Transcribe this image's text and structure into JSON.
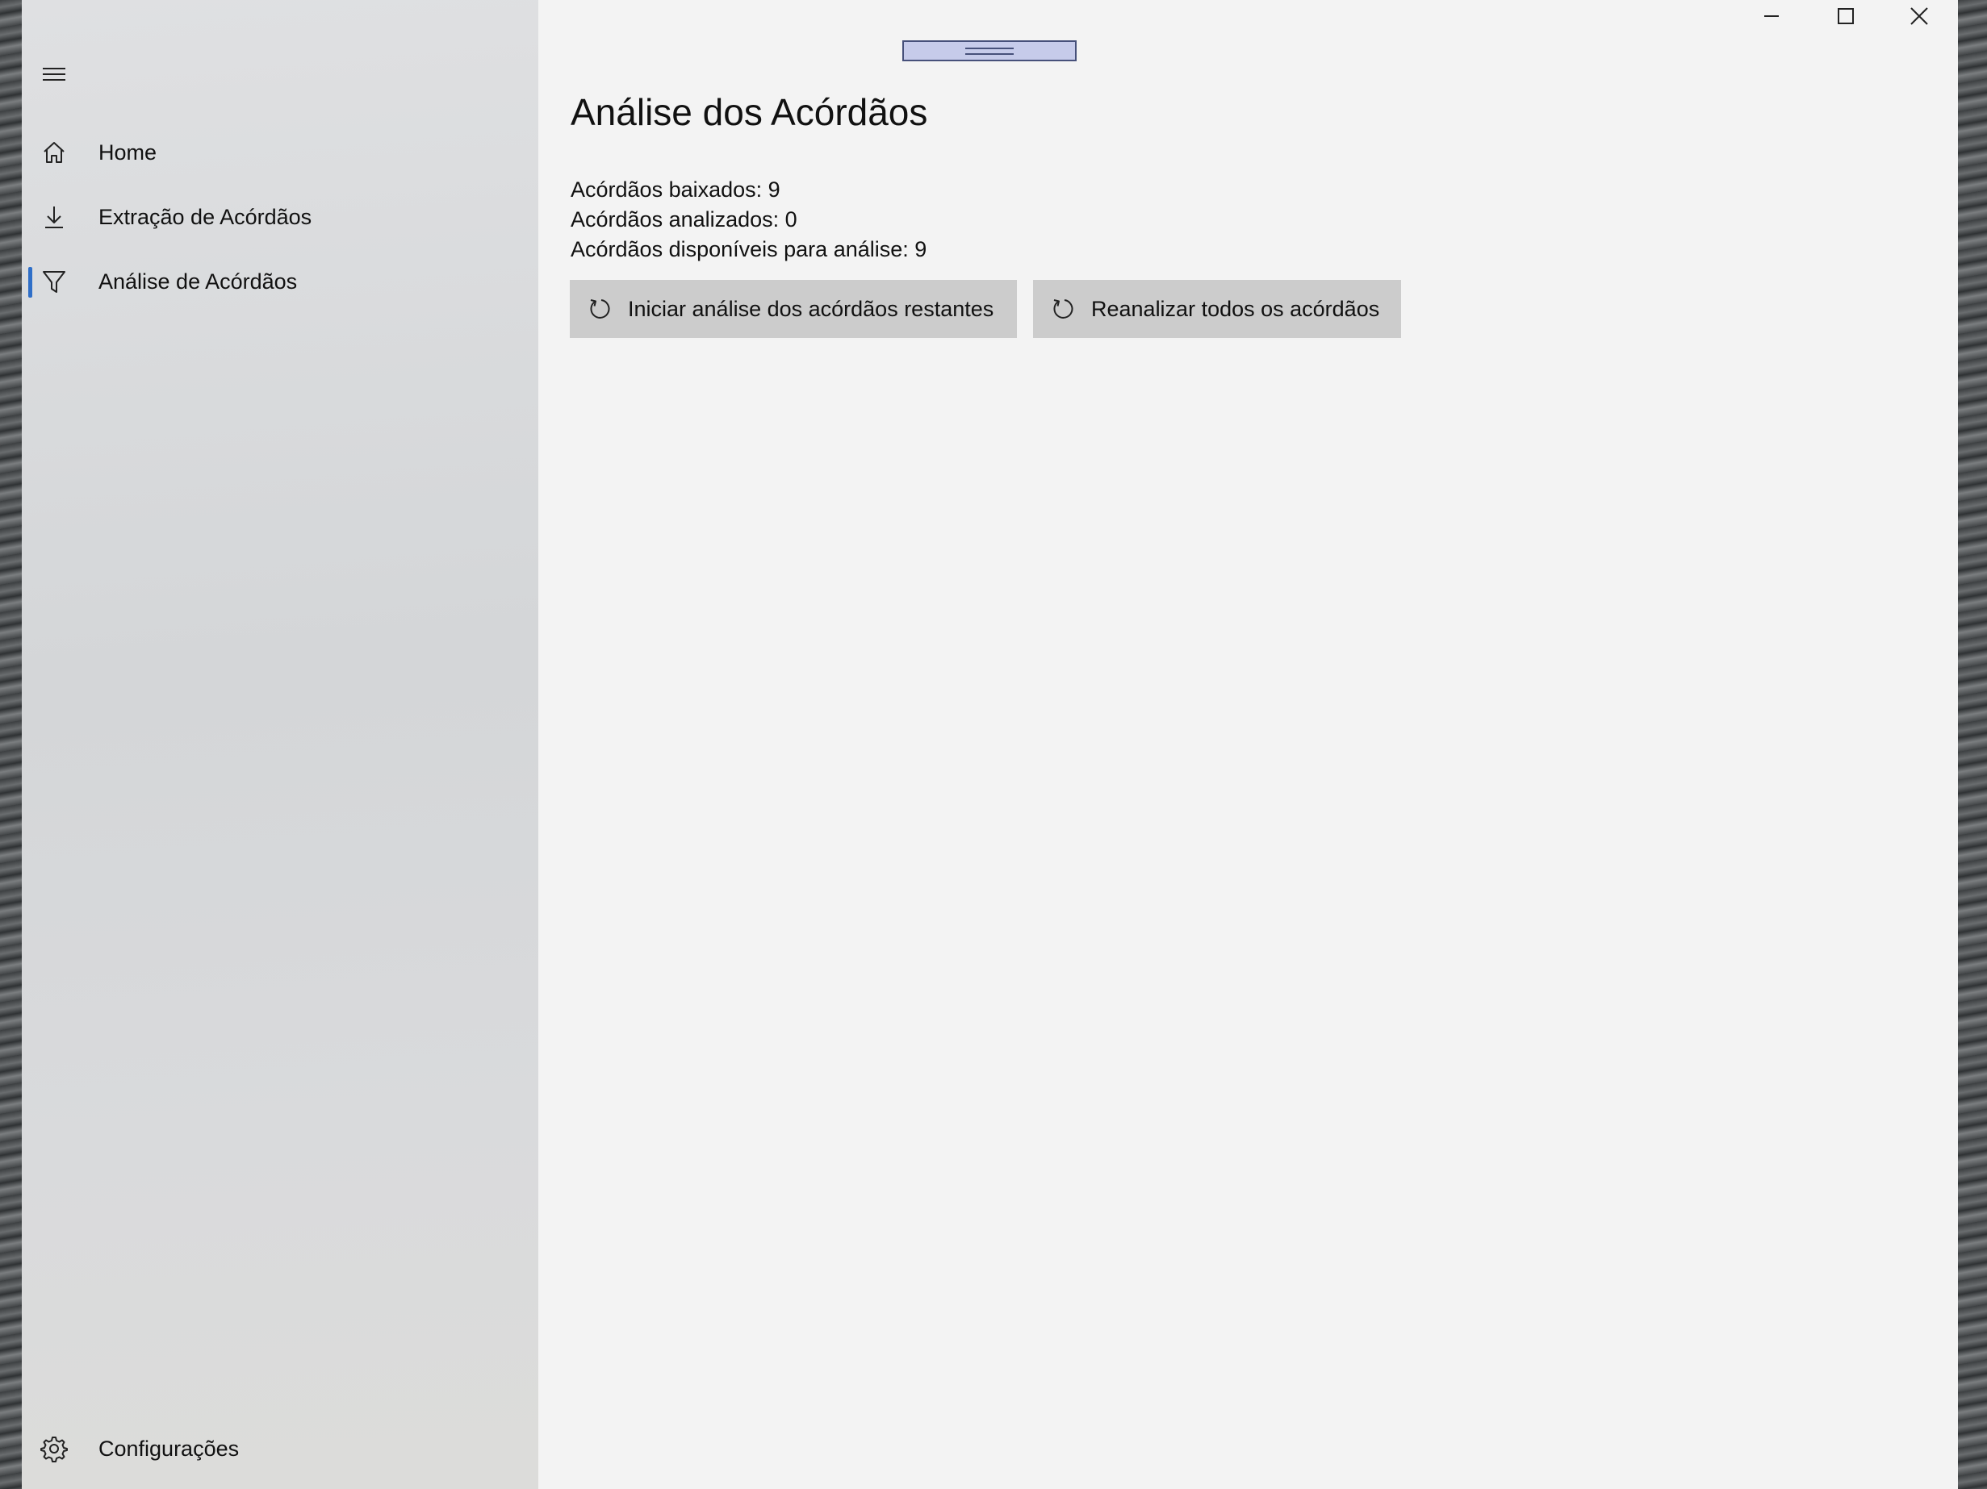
{
  "window": {
    "accent_color": "#2f6fc8",
    "caption_buttons": {
      "minimize_icon": "minimize-icon",
      "maximize_icon": "maximize-icon",
      "close_icon": "close-icon"
    }
  },
  "nav": {
    "menu_icon": "hamburger-menu-icon",
    "items": [
      {
        "label": "Home",
        "icon": "home-icon",
        "selected": false
      },
      {
        "label": "Extração de Acórdãos",
        "icon": "download-icon",
        "selected": false
      },
      {
        "label": "Análise de Acórdãos",
        "icon": "filter-icon",
        "selected": true
      }
    ],
    "settings": {
      "label": "Configurações",
      "icon": "gear-icon"
    }
  },
  "page": {
    "title": "Análise dos Acórdãos",
    "stats": {
      "downloaded": "Acórdãos baixados: 9",
      "analyzed": "Acórdãos analizados: 0",
      "available": "Acórdãos disponíveis para análise: 9"
    },
    "buttons": {
      "start_label": "Iniciar análise dos acórdãos restantes",
      "reanalyze_label": "Reanalizar todos os acórdãos",
      "icon": "refresh-icon"
    }
  }
}
